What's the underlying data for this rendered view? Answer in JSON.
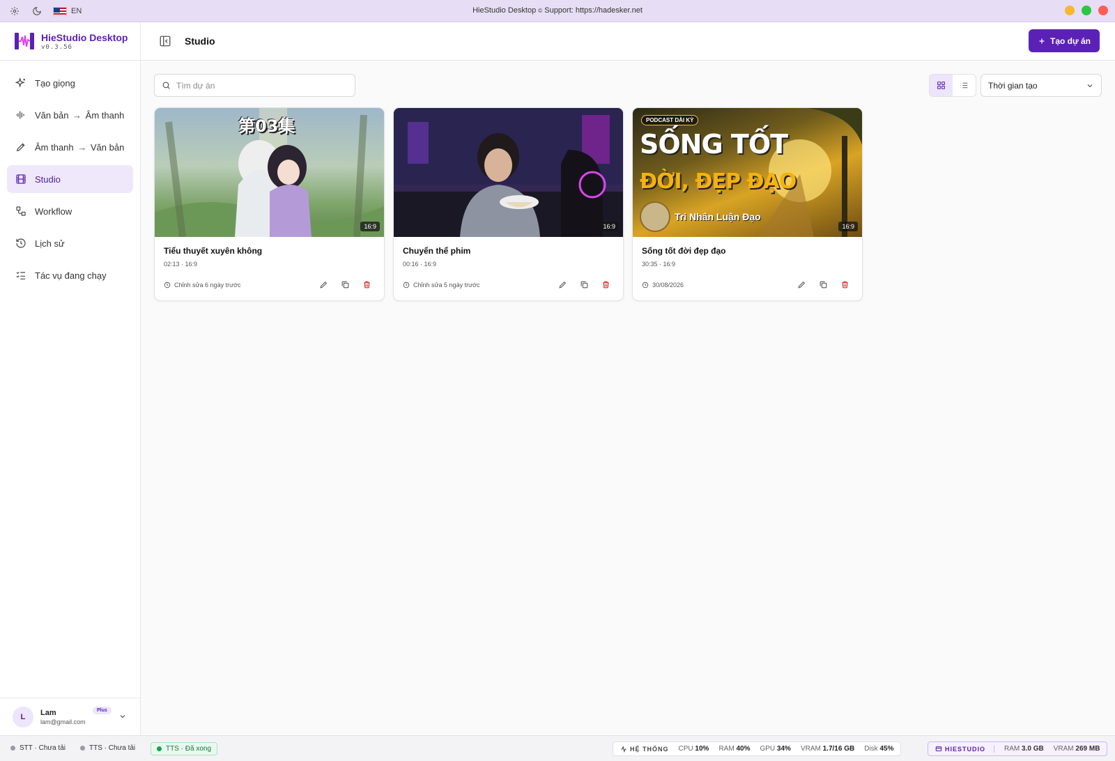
{
  "window": {
    "title": "HieStudio Desktop",
    "support": "Support: https://hadesker.net",
    "language": "EN",
    "traffic_colors": [
      "#f5b82e",
      "#29c840",
      "#ff5f57"
    ]
  },
  "brand": {
    "name": "HieStudio Desktop",
    "version": "v0.3.56",
    "accent": "#5b21b6"
  },
  "sidebar": {
    "items": [
      {
        "label": "Tạo giọng",
        "icon": "sparkles-icon"
      },
      {
        "label_a": "Văn bản",
        "label_b": "Âm thanh",
        "icon": "audio-waveform-icon"
      },
      {
        "label_a": "Âm thanh",
        "label_b": "Văn bản",
        "icon": "pen-icon"
      },
      {
        "label": "Studio",
        "icon": "film-icon",
        "active": true
      },
      {
        "label": "Workflow",
        "icon": "workflow-icon"
      },
      {
        "label": "Lịch sử",
        "icon": "history-icon"
      },
      {
        "label": "Tác vụ đang chạy",
        "icon": "list-checks-icon"
      }
    ],
    "user": {
      "initial": "L",
      "name": "Lam",
      "email": "lam@gmail.com",
      "plan": "Plus"
    }
  },
  "header": {
    "title": "Studio",
    "create_label": "Tạo dự án"
  },
  "toolbar": {
    "search_placeholder": "Tìm dự án",
    "sort_value": "Thời gian tạo",
    "view_mode": "grid"
  },
  "projects": [
    {
      "title": "Tiểu thuyết xuyên không",
      "meta": "02:13 · 16:9",
      "edited": "Chỉnh sửa 6 ngày trước",
      "ratio": "16:9",
      "thumb_text": "第03集"
    },
    {
      "title": "Chuyển thể phim",
      "meta": "00:16 · 16:9",
      "edited": "Chỉnh sửa 5 ngày trước",
      "ratio": "16:9",
      "thumb_text": ""
    },
    {
      "title": "Sống tốt đời đẹp đạo",
      "meta": "30:35 · 16:9",
      "edited": "30/08/2026",
      "ratio": "16:9",
      "thumb_text": "SỐNG TỐT",
      "thumb_text2": "ĐỜI, ĐẸP ĐẠO",
      "thumb_badge": "PODCAST DÀI KỲ",
      "thumb_sub": "Tri Nhân Luận Đạo"
    }
  ],
  "status": {
    "stt": "STT · Chưa tải",
    "tts": "TTS · Chưa tải",
    "tts_done": "TTS · Đã xong",
    "system_label": "HỆ THỐNG",
    "cpu_label": "CPU",
    "cpu": "10%",
    "ram_label": "RAM",
    "ram": "40%",
    "gpu_label": "GPU",
    "gpu": "34%",
    "vram_label": "VRAM",
    "vram": "1.7/16 GB",
    "disk_label": "Disk",
    "disk": "45%",
    "app_label": "HIESTUDIO",
    "app_ram_label": "RAM",
    "app_ram": "3.0 GB",
    "app_vram_label": "VRAM",
    "app_vram": "269 MB"
  }
}
